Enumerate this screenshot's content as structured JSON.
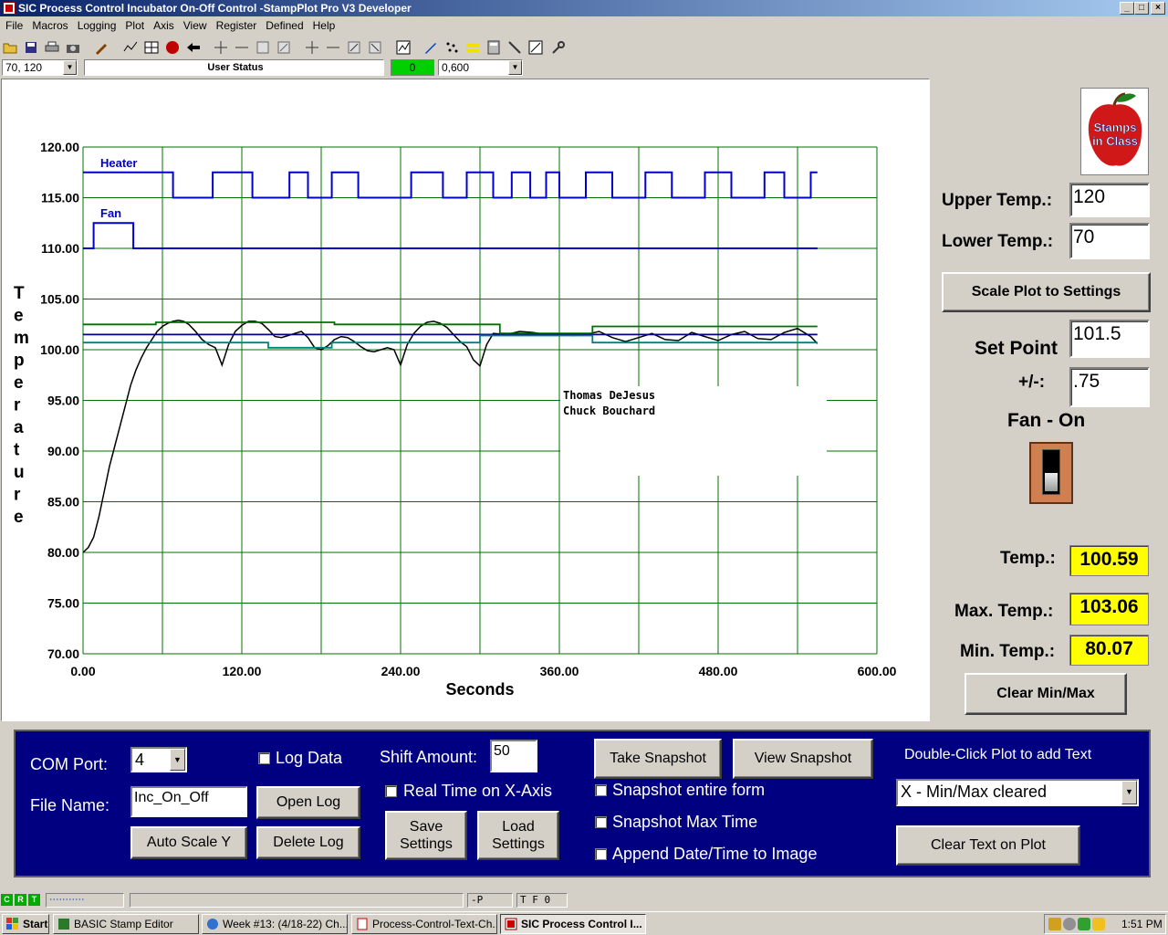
{
  "window": {
    "title": "SIC Process Control Incubator On-Off Control -StampPlot Pro V3 Developer",
    "min_glyph": "_",
    "max_glyph": "□",
    "close_glyph": "×"
  },
  "menu": [
    "File",
    "Macros",
    "Logging",
    "Plot",
    "Axis",
    "View",
    "Register",
    "Defined",
    "Help"
  ],
  "toolbar": {
    "icons": [
      "open-folder-icon",
      "save-icon",
      "print-icon",
      "camera-icon",
      "pen-icon",
      "plot-icon",
      "grid-icon",
      "stop-icon",
      "back-arrow-icon",
      "expand-x-icon",
      "shrink-x-icon",
      "zoom-box-icon",
      "zoom-box2-icon",
      "expand-y-icon",
      "shrink-y-icon",
      "shift-up-icon",
      "shift-down-icon",
      "chart-icon",
      "marker-icon",
      "scatter-icon",
      "highlight-icon",
      "calculator-icon",
      "probe-icon",
      "resize-icon",
      "key-icon"
    ]
  },
  "statusrow": {
    "coord_combo": "70, 120",
    "user_status": "User Status",
    "counter": "0",
    "range_combo": "0,600"
  },
  "plot": {
    "heater_label": "Heater",
    "fan_label": "Fan",
    "annotation_line1": "Thomas DeJesus",
    "annotation_line2": "Chuck Bouchard"
  },
  "chart_data": {
    "type": "line",
    "xlabel": "Seconds",
    "ylabel": "Temperature",
    "xlim": [
      0,
      600
    ],
    "ylim": [
      70,
      120
    ],
    "grid": true,
    "x_tick_labels": [
      "0.00",
      "120.00",
      "240.00",
      "360.00",
      "480.00",
      "600.00"
    ],
    "y_tick_labels": [
      "70.00",
      "75.00",
      "80.00",
      "85.00",
      "90.00",
      "95.00",
      "100.00",
      "105.00",
      "110.00",
      "115.00",
      "120.00"
    ],
    "series": [
      {
        "name": "Heater",
        "color": "#0000cc",
        "x": [
          0,
          68,
          68,
          98,
          98,
          128,
          128,
          156,
          156,
          170,
          170,
          188,
          188,
          208,
          208,
          248,
          248,
          272,
          272,
          290,
          290,
          310,
          310,
          324,
          324,
          338,
          338,
          350,
          350,
          360,
          360,
          380,
          380,
          400,
          400,
          425,
          425,
          445,
          445,
          470,
          470,
          490,
          490,
          515,
          515,
          530,
          530,
          550,
          550,
          555
        ],
        "y": [
          117.5,
          117.5,
          115,
          115,
          117.5,
          117.5,
          115,
          115,
          117.5,
          117.5,
          115,
          115,
          117.5,
          117.5,
          115,
          115,
          117.5,
          117.5,
          115,
          115,
          117.5,
          117.5,
          115,
          115,
          117.5,
          117.5,
          115,
          115,
          117.5,
          117.5,
          115,
          115,
          117.5,
          117.5,
          115,
          115,
          117.5,
          117.5,
          115,
          115,
          117.5,
          117.5,
          115,
          115,
          117.5,
          117.5,
          115,
          115,
          117.5,
          117.5
        ]
      },
      {
        "name": "Fan",
        "color": "#0000cc",
        "x": [
          0,
          8,
          8,
          38,
          38,
          555
        ],
        "y": [
          110,
          110,
          112.5,
          112.5,
          110,
          110
        ]
      },
      {
        "name": "Temperature",
        "color": "#000000",
        "x": [
          0,
          4,
          8,
          12,
          16,
          20,
          24,
          28,
          32,
          36,
          40,
          44,
          48,
          52,
          56,
          60,
          64,
          68,
          72,
          76,
          80,
          85,
          90,
          95,
          100,
          105,
          110,
          115,
          120,
          125,
          130,
          135,
          140,
          145,
          150,
          155,
          160,
          165,
          170,
          175,
          180,
          185,
          190,
          195,
          200,
          205,
          210,
          215,
          220,
          225,
          230,
          235,
          240,
          245,
          250,
          255,
          260,
          265,
          270,
          275,
          280,
          285,
          290,
          295,
          300,
          305,
          310,
          320,
          330,
          340,
          350,
          360,
          370,
          380,
          390,
          400,
          410,
          420,
          430,
          440,
          450,
          460,
          470,
          480,
          490,
          500,
          510,
          520,
          530,
          540,
          550,
          555
        ],
        "y": [
          80.0,
          80.5,
          81.5,
          83.5,
          86.0,
          88.5,
          90.5,
          92.5,
          94.5,
          96.5,
          98.0,
          99.2,
          100.2,
          101.0,
          101.8,
          102.3,
          102.6,
          102.8,
          102.9,
          102.8,
          102.5,
          101.8,
          101.0,
          100.5,
          100.2,
          98.5,
          100.5,
          101.8,
          102.4,
          102.8,
          102.8,
          102.6,
          102.0,
          101.3,
          101.2,
          101.4,
          101.6,
          101.8,
          101.2,
          100.2,
          100.0,
          100.4,
          101.0,
          101.3,
          101.2,
          100.8,
          100.3,
          99.9,
          99.8,
          100.0,
          100.2,
          100.0,
          98.5,
          100.5,
          101.6,
          102.3,
          102.7,
          102.8,
          102.6,
          102.2,
          101.5,
          100.8,
          100.3,
          99.0,
          98.4,
          100.5,
          101.6,
          101.5,
          101.8,
          101.7,
          101.5,
          101.6,
          101.4,
          101.5,
          101.8,
          101.2,
          100.8,
          101.2,
          101.6,
          101.0,
          100.9,
          101.7,
          101.3,
          100.9,
          101.5,
          101.8,
          101.1,
          101.0,
          101.7,
          102.1,
          101.3,
          100.6
        ]
      },
      {
        "name": "Upper Limit",
        "color": "#007000",
        "x": [
          0,
          55,
          55,
          190,
          190,
          315,
          315,
          385,
          385,
          555
        ],
        "y": [
          102.5,
          102.5,
          102.7,
          102.7,
          102.5,
          102.5,
          101.6,
          101.6,
          102.3,
          102.3
        ]
      },
      {
        "name": "Set Point",
        "color": "#000080",
        "x": [
          0,
          555
        ],
        "y": [
          101.5,
          101.5
        ]
      },
      {
        "name": "Lower Limit",
        "color": "#008080",
        "x": [
          0,
          140,
          140,
          188,
          188,
          300,
          300,
          385,
          385,
          555
        ],
        "y": [
          100.7,
          100.7,
          100.2,
          100.2,
          100.7,
          100.7,
          101.4,
          101.4,
          100.7,
          100.7
        ]
      }
    ]
  },
  "settings": {
    "upper_label": "Upper Temp.:",
    "upper_value": "120",
    "lower_label": "Lower Temp.:",
    "lower_value": "70",
    "scale_button": "Scale Plot to Settings",
    "setpoint_label": "Set Point",
    "setpoint_value": "101.5",
    "tolerance_label": "+/-:",
    "tolerance_value": ".75",
    "fan_status": "Fan - On",
    "temp_label": "Temp.:",
    "temp_value": "100.59",
    "max_label": "Max. Temp.:",
    "max_value": "103.06",
    "min_label": "Min. Temp.:",
    "min_value": "80.07",
    "clear_button": "Clear Min/Max",
    "logo_line1": "Stamps",
    "logo_line2": "in Class"
  },
  "controls": {
    "com_label": "COM Port:",
    "com_value": "4",
    "file_label": "File Name:",
    "file_value": "Inc_On_Off",
    "log_data": "Log Data",
    "open_log": "Open Log",
    "delete_log": "Delete Log",
    "auto_scale": "Auto Scale Y",
    "shift_label": "Shift Amount:",
    "shift_value": "50",
    "realtime": "Real Time on X-Axis",
    "save_settings_1": "Save",
    "save_settings_2": "Settings",
    "load_settings_1": "Load",
    "load_settings_2": "Settings",
    "take_snapshot": "Take Snapshot",
    "view_snapshot": "View Snapshot",
    "snap_form": "Snapshot entire form",
    "snap_max": "Snapshot Max Time",
    "append_date": "Append Date/Time to Image",
    "dblclick_hint": "Double-Click Plot to add Text",
    "text_combo": "X - Min/Max cleared",
    "clear_text": "Clear Text on Plot"
  },
  "statusbar": {
    "leds": [
      "C",
      "R",
      "T"
    ],
    "progress": "‧‧‧‧‧‧‧‧‧‧‧",
    "mode": "-P",
    "flags": "T F 0"
  },
  "taskbar": {
    "start": "Start",
    "items": [
      "BASIC Stamp Editor",
      "Week #13: (4/18-22) Ch...",
      "Process-Control-Text-Ch...",
      "SIC Process Control I..."
    ],
    "clock": "1:51 PM"
  }
}
